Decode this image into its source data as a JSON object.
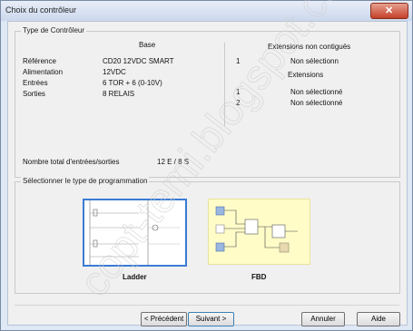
{
  "window": {
    "title": "Choix du contrôleur"
  },
  "controller_type": {
    "legend": "Type de Contrôleur",
    "base_header": "Base",
    "rows": [
      {
        "label": "Référence",
        "value": "CD20  12VDC SMART"
      },
      {
        "label": "Alimentation",
        "value": "12VDC"
      },
      {
        "label": "Entrées",
        "value": "6 TOR + 6 (0-10V)"
      },
      {
        "label": "Sorties",
        "value": "8 RELAIS"
      }
    ],
    "extensions_noncontig_header": "Extensions non contiguës",
    "noncontig_items": [
      {
        "index": "1",
        "value": "Non sélectionn"
      }
    ],
    "extensions_header": "Extensions",
    "ext_items": [
      {
        "index": "1",
        "value": "Non sélectionné"
      },
      {
        "index": "2",
        "value": "Non sélectionné"
      }
    ],
    "total_label": "Nombre total d'entrées/sorties",
    "total_value": "12 E / 8 S"
  },
  "programming": {
    "legend": "Sélectionner le type de programmation",
    "options": [
      {
        "label": "Ladder"
      },
      {
        "label": "FBD"
      }
    ]
  },
  "buttons": {
    "previous": "< Précédent",
    "next": "Suivant >",
    "cancel": "Annuler",
    "help": "Aide"
  },
  "watermark": "copt-temi.blogspot.com",
  "colors": {
    "title_bar": "#cbd8ec",
    "close_button": "#c4402a",
    "selection_border": "#3a7bd5",
    "fbd_background": "#fffcc8"
  }
}
